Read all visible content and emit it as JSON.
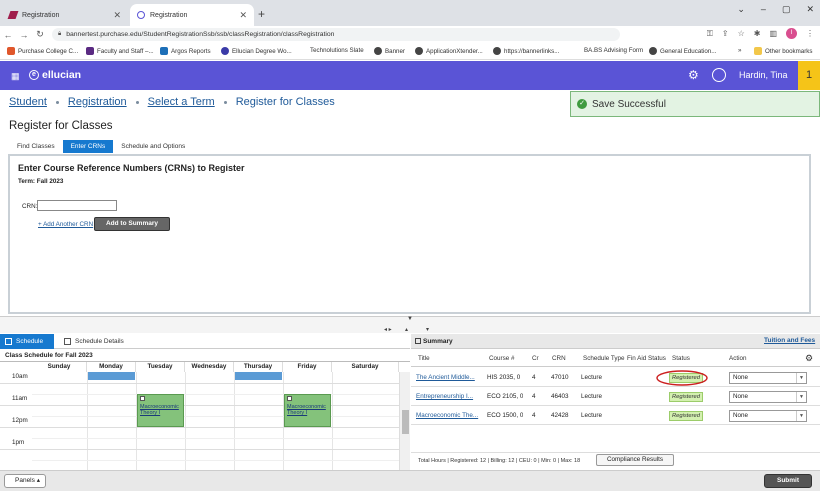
{
  "browser": {
    "tabs": [
      {
        "label": "Registration",
        "active": false
      },
      {
        "label": "Registration",
        "active": true
      }
    ],
    "url": "bannertest.purchase.edu/StudentRegistrationSsb/ssb/classRegistration/classRegistration",
    "bookmarks": [
      {
        "label": "Purchase College C...",
        "color": "#e0572b"
      },
      {
        "label": "Faculty and Staff –...",
        "color": "#5a2a82"
      },
      {
        "label": "Argos Reports",
        "color": "#1d6fb8"
      },
      {
        "label": "Ellucian Degree Wo...",
        "color": "#3b3ba8"
      },
      {
        "label": "Technolutions Slate",
        "color": "#ffffff"
      },
      {
        "label": "Banner",
        "color": "#444444"
      },
      {
        "label": "ApplicationXtender...",
        "color": "#444444"
      },
      {
        "label": "https://bannerlinks...",
        "color": "#444444"
      },
      {
        "label": "BA.BS Advising Form",
        "color": "#ffffff"
      },
      {
        "label": "General Education...",
        "color": "#444444"
      }
    ],
    "overflow": "»",
    "other_bookmarks": "Other bookmarks",
    "avatar_letter": "I"
  },
  "header": {
    "brand": "ellucian",
    "user_name": "Hardin, Tina",
    "notification_count": "1"
  },
  "breadcrumb": [
    "Student",
    "Registration",
    "Select a Term",
    "Register for Classes"
  ],
  "toast": "Save Successful",
  "page_title": "Register for Classes",
  "reg_tabs": [
    "Find Classes",
    "Enter CRNs",
    "Schedule and Options"
  ],
  "crn_panel": {
    "heading": "Enter Course Reference Numbers (CRNs) to Register",
    "term": "Term: Fall 2023",
    "crn_label": "CRN:",
    "crn_value": "",
    "add_another": "+ Add Another CRN",
    "add_to_summary": "Add to Summary"
  },
  "schedule": {
    "tab_schedule": "Schedule",
    "tab_details": "Schedule Details",
    "title": "Class Schedule for Fall 2023",
    "days": [
      "Sunday",
      "Monday",
      "Tuesday",
      "Wednesday",
      "Thursday",
      "Friday",
      "Saturday"
    ],
    "hours": [
      "10am",
      "11am",
      "12pm",
      "1pm"
    ],
    "events": [
      {
        "day": 1,
        "start": 9.0,
        "end": 9.85,
        "color": "#5b9bd5",
        "label": ""
      },
      {
        "day": 4,
        "start": 9.0,
        "end": 9.85,
        "color": "#5b9bd5",
        "label": ""
      },
      {
        "day": 2,
        "start": 10.5,
        "end": 12.0,
        "color": "#84c27b",
        "label": "Macroeconomic Theory I"
      },
      {
        "day": 5,
        "start": 10.5,
        "end": 12.0,
        "color": "#84c27b",
        "label": "Macroeconomic Theory I"
      }
    ]
  },
  "summary": {
    "title": "Summary",
    "tuition_link": "Tuition and Fees",
    "columns": [
      "Title",
      "Course #",
      "Cr",
      "CRN",
      "Schedule Type",
      "Fin Aid Status",
      "Status",
      "Action"
    ],
    "rows": [
      {
        "title": "The Ancient Middle...",
        "course": "HIS 2035, 0",
        "cr": "4",
        "crn": "47010",
        "type": "Lecture",
        "fin_aid": "",
        "status": "Registered",
        "action": "None"
      },
      {
        "title": "Entrepreneurship I...",
        "course": "ECO 2105, 0",
        "cr": "4",
        "crn": "46403",
        "type": "Lecture",
        "fin_aid": "",
        "status": "Registered",
        "action": "None"
      },
      {
        "title": "Macroeconomic The...",
        "course": "ECO 1500, 0",
        "cr": "4",
        "crn": "42428",
        "type": "Lecture",
        "fin_aid": "",
        "status": "Registered",
        "action": "None"
      }
    ],
    "totals": "Total Hours | Registered: 12 | Billing: 12 | CEU: 0 | Min: 0 | Max: 18",
    "compliance": "Compliance Results"
  },
  "footer": {
    "panels": "Panels",
    "submit": "Submit"
  },
  "colors": {
    "header_bg": "#5a54d6",
    "notif_bg": "#f5c418",
    "tab_active": "#1679cf",
    "highlight_circle": "#cc1f1f"
  }
}
